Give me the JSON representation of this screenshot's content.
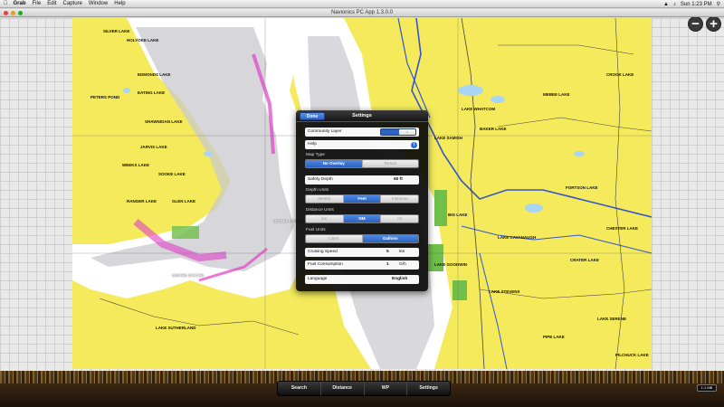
{
  "menubar": {
    "app_name": "Grab",
    "items": [
      "File",
      "Edit",
      "Capture",
      "Window",
      "Help"
    ],
    "clock": "Sun 1:23 PM"
  },
  "window": {
    "title": "Navionics PC App 1.3.0.0"
  },
  "map": {
    "labels": [
      "SILVER LAKE",
      "HOLYOKE LAKE",
      "EDMONDS LAKE",
      "PETERS POND",
      "EATING LAKE",
      "SHAWNIGAN LAKE",
      "JARVIS LAKE",
      "WEEKS LAKE",
      "SOOKE LAKE",
      "RANGER LAKE",
      "GLEN LAKE",
      "UNITED STATES",
      "UNITED STATES",
      "LAKE SUTHERLAND",
      "CROOK LAKE",
      "LAKE WHATCOM",
      "MEBEE LAKE",
      "BAKER LAKE",
      "LAKE SAMISH",
      "BIG LAKE",
      "LAKE CAVANAUGH",
      "LAKE GOODWIN",
      "LAKE STEVENS",
      "FORTSON LAKE",
      "CHESTER LAKE",
      "CRATER LAKE",
      "LAKE SERENE",
      "PIPE LAKE",
      "PILCHUCK LAKE"
    ]
  },
  "settings": {
    "title": "Settings",
    "done_label": "Done",
    "community_layer_label": "Community Layer",
    "community_layer_state": "I",
    "help_label": "Help",
    "help_icon": "i",
    "map_type_label": "Map Type",
    "map_type_options": [
      "No Overlay",
      "Terrain"
    ],
    "safety_depth_label": "Safety Depth",
    "safety_depth_value": "60 ft",
    "depth_units_label": "Depth Units",
    "depth_units_options": [
      "Meters",
      "Feet",
      "Fathoms"
    ],
    "distance_units_label": "Distance Units",
    "distance_units_options": [
      "km",
      "NM",
      "mi"
    ],
    "fuel_units_label": "Fuel Units",
    "fuel_units_options": [
      "Liters",
      "Gallons"
    ],
    "cruising_speed_label": "Cruising Speed",
    "cruising_speed_value": "5",
    "cruising_speed_unit": "kts",
    "fuel_consumption_label": "Fuel Consumption",
    "fuel_consumption_value": "1",
    "fuel_consumption_unit": "G/h",
    "language_label": "Language",
    "language_value": "English"
  },
  "toolbar": {
    "items": [
      "Search",
      "Distance",
      "WP",
      "Settings"
    ]
  },
  "zoom": {
    "out_label": "−",
    "in_label": "+"
  },
  "dock": {
    "clock_badge": "1:1 MB"
  }
}
